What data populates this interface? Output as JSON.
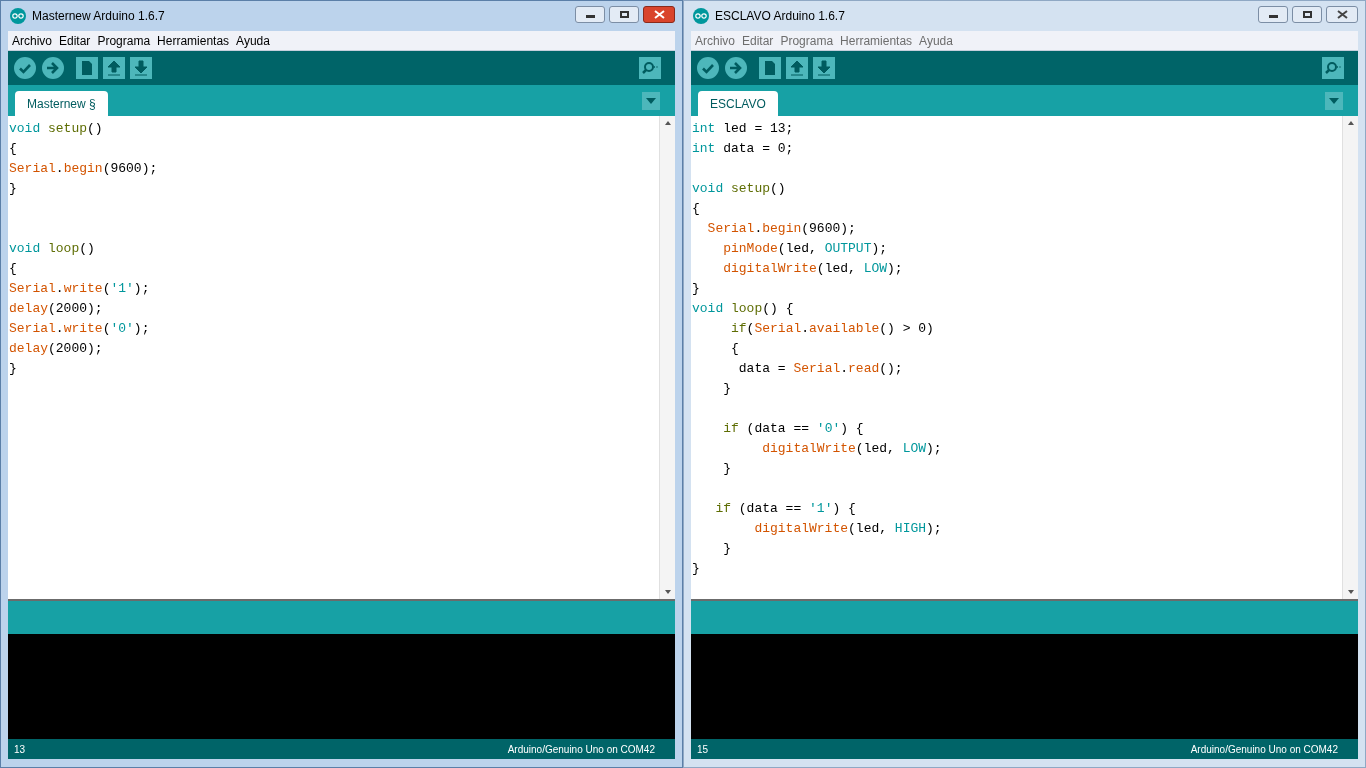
{
  "windows": [
    {
      "title": "Masternew Arduino 1.6.7",
      "active": true,
      "menu": [
        "Archivo",
        "Editar",
        "Programa",
        "Herramientas",
        "Ayuda"
      ],
      "tab": "Masternew §",
      "code": [
        {
          "kind": "code",
          "tokens": [
            {
              "kind": "type",
              "text": "void "
            },
            {
              "kind": "func",
              "text": "setup"
            },
            {
              "kind": "plain",
              "text": "()"
            }
          ]
        },
        {
          "kind": "code",
          "tokens": [
            {
              "kind": "plain",
              "text": "{"
            }
          ]
        },
        {
          "kind": "code",
          "tokens": [
            {
              "kind": "core",
              "text": "Serial"
            },
            {
              "kind": "plain",
              "text": "."
            },
            {
              "kind": "core",
              "text": "begin"
            },
            {
              "kind": "plain",
              "text": "(9600);"
            }
          ]
        },
        {
          "kind": "code",
          "tokens": [
            {
              "kind": "plain",
              "text": "}"
            }
          ]
        },
        {
          "kind": "blank"
        },
        {
          "kind": "blank"
        },
        {
          "kind": "code",
          "tokens": [
            {
              "kind": "type",
              "text": "void "
            },
            {
              "kind": "func",
              "text": "loop"
            },
            {
              "kind": "plain",
              "text": "()"
            }
          ]
        },
        {
          "kind": "code",
          "tokens": [
            {
              "kind": "plain",
              "text": "{"
            }
          ]
        },
        {
          "kind": "code",
          "tokens": [
            {
              "kind": "core",
              "text": "Serial"
            },
            {
              "kind": "plain",
              "text": "."
            },
            {
              "kind": "core",
              "text": "write"
            },
            {
              "kind": "plain",
              "text": "("
            },
            {
              "kind": "string",
              "text": "'1'"
            },
            {
              "kind": "plain",
              "text": ");"
            }
          ]
        },
        {
          "kind": "code",
          "tokens": [
            {
              "kind": "core",
              "text": "delay"
            },
            {
              "kind": "plain",
              "text": "(2000);"
            }
          ]
        },
        {
          "kind": "code",
          "tokens": [
            {
              "kind": "core",
              "text": "Serial"
            },
            {
              "kind": "plain",
              "text": "."
            },
            {
              "kind": "core",
              "text": "write"
            },
            {
              "kind": "plain",
              "text": "("
            },
            {
              "kind": "string",
              "text": "'0'"
            },
            {
              "kind": "plain",
              "text": ");"
            }
          ]
        },
        {
          "kind": "code",
          "tokens": [
            {
              "kind": "core",
              "text": "delay"
            },
            {
              "kind": "plain",
              "text": "(2000);"
            }
          ]
        },
        {
          "kind": "code",
          "tokens": [
            {
              "kind": "plain",
              "text": "}"
            }
          ]
        }
      ],
      "status_line": "13",
      "board": "Arduino/Genuino Uno on COM42"
    },
    {
      "title": "ESCLAVO Arduino 1.6.7",
      "active": false,
      "menu": [
        "Archivo",
        "Editar",
        "Programa",
        "Herramientas",
        "Ayuda"
      ],
      "tab": "ESCLAVO",
      "code": [
        {
          "kind": "code",
          "tokens": [
            {
              "kind": "type",
              "text": "int"
            },
            {
              "kind": "plain",
              "text": " led = 13;"
            }
          ]
        },
        {
          "kind": "code",
          "tokens": [
            {
              "kind": "type",
              "text": "int"
            },
            {
              "kind": "plain",
              "text": " data = 0;"
            }
          ]
        },
        {
          "kind": "blank"
        },
        {
          "kind": "code",
          "tokens": [
            {
              "kind": "type",
              "text": "void "
            },
            {
              "kind": "func",
              "text": "setup"
            },
            {
              "kind": "plain",
              "text": "()"
            }
          ]
        },
        {
          "kind": "code",
          "tokens": [
            {
              "kind": "plain",
              "text": "{"
            }
          ]
        },
        {
          "kind": "code",
          "tokens": [
            {
              "kind": "core",
              "text": "  Serial"
            },
            {
              "kind": "plain",
              "text": "."
            },
            {
              "kind": "core",
              "text": "begin"
            },
            {
              "kind": "plain",
              "text": "(9600);"
            }
          ]
        },
        {
          "kind": "code",
          "tokens": [
            {
              "kind": "core",
              "text": "    pinMode"
            },
            {
              "kind": "plain",
              "text": "(led, "
            },
            {
              "kind": "const",
              "text": "OUTPUT"
            },
            {
              "kind": "plain",
              "text": ");"
            }
          ]
        },
        {
          "kind": "code",
          "tokens": [
            {
              "kind": "core",
              "text": "    digitalWrite"
            },
            {
              "kind": "plain",
              "text": "(led, "
            },
            {
              "kind": "const",
              "text": "LOW"
            },
            {
              "kind": "plain",
              "text": ");"
            }
          ]
        },
        {
          "kind": "code",
          "tokens": [
            {
              "kind": "plain",
              "text": "}"
            }
          ]
        },
        {
          "kind": "code",
          "tokens": [
            {
              "kind": "type",
              "text": "void "
            },
            {
              "kind": "func",
              "text": "loop"
            },
            {
              "kind": "plain",
              "text": "() {"
            }
          ]
        },
        {
          "kind": "code",
          "tokens": [
            {
              "kind": "keyword",
              "text": "     if"
            },
            {
              "kind": "plain",
              "text": "("
            },
            {
              "kind": "core",
              "text": "Serial"
            },
            {
              "kind": "plain",
              "text": "."
            },
            {
              "kind": "core",
              "text": "available"
            },
            {
              "kind": "plain",
              "text": "() > 0)"
            }
          ]
        },
        {
          "kind": "code",
          "tokens": [
            {
              "kind": "plain",
              "text": "     {"
            }
          ]
        },
        {
          "kind": "code",
          "tokens": [
            {
              "kind": "plain",
              "text": "      data = "
            },
            {
              "kind": "core",
              "text": "Serial"
            },
            {
              "kind": "plain",
              "text": "."
            },
            {
              "kind": "core",
              "text": "read"
            },
            {
              "kind": "plain",
              "text": "();"
            }
          ]
        },
        {
          "kind": "code",
          "tokens": [
            {
              "kind": "plain",
              "text": "    }"
            }
          ]
        },
        {
          "kind": "blank"
        },
        {
          "kind": "code",
          "tokens": [
            {
              "kind": "keyword",
              "text": "    if"
            },
            {
              "kind": "plain",
              "text": " (data == "
            },
            {
              "kind": "string",
              "text": "'0'"
            },
            {
              "kind": "plain",
              "text": ") {"
            }
          ]
        },
        {
          "kind": "code",
          "tokens": [
            {
              "kind": "core",
              "text": "         digitalWrite"
            },
            {
              "kind": "plain",
              "text": "(led, "
            },
            {
              "kind": "const",
              "text": "LOW"
            },
            {
              "kind": "plain",
              "text": ");"
            }
          ]
        },
        {
          "kind": "code",
          "tokens": [
            {
              "kind": "plain",
              "text": "    }"
            }
          ]
        },
        {
          "kind": "blank"
        },
        {
          "kind": "code",
          "tokens": [
            {
              "kind": "keyword",
              "text": "   if"
            },
            {
              "kind": "plain",
              "text": " (data == "
            },
            {
              "kind": "string",
              "text": "'1'"
            },
            {
              "kind": "plain",
              "text": ") {"
            }
          ]
        },
        {
          "kind": "code",
          "tokens": [
            {
              "kind": "core",
              "text": "        digitalWrite"
            },
            {
              "kind": "plain",
              "text": "(led, "
            },
            {
              "kind": "const",
              "text": "HIGH"
            },
            {
              "kind": "plain",
              "text": ");"
            }
          ]
        },
        {
          "kind": "code",
          "tokens": [
            {
              "kind": "plain",
              "text": "    }"
            }
          ]
        },
        {
          "kind": "code",
          "tokens": [
            {
              "kind": "plain",
              "text": "}"
            }
          ]
        }
      ],
      "status_line": "15",
      "board": "Arduino/Genuino Uno on COM42"
    }
  ]
}
